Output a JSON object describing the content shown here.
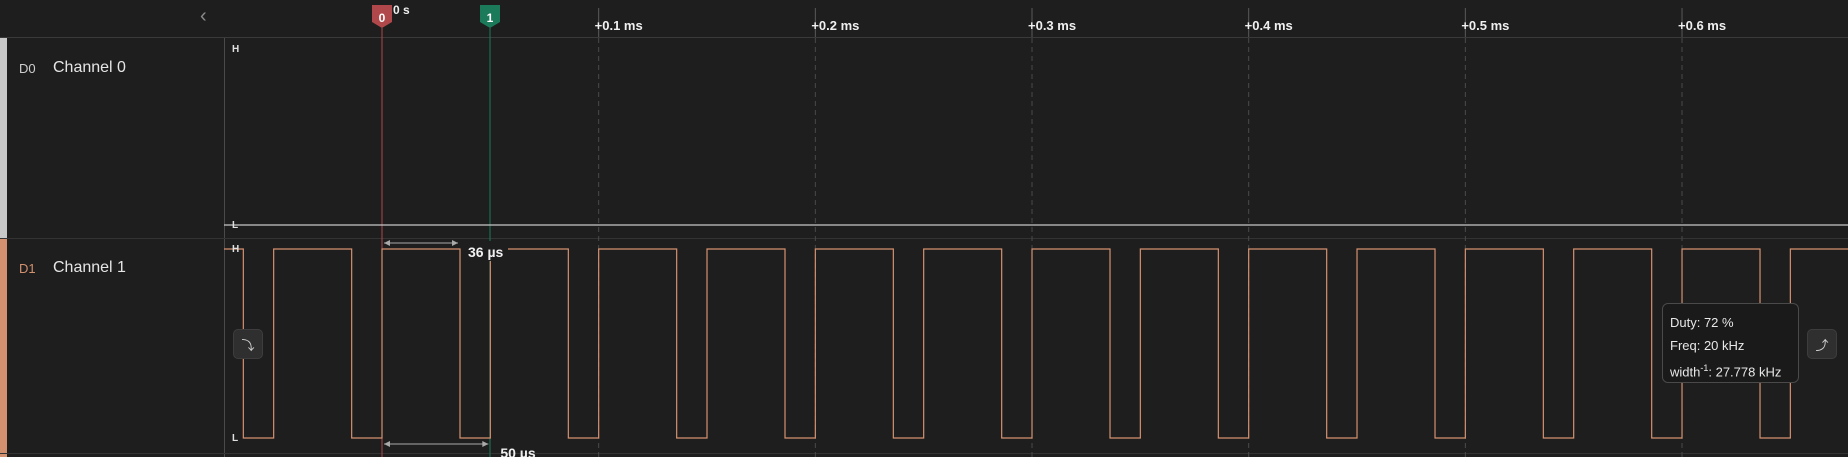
{
  "header": {
    "collapse_icon": "chevron-left-icon",
    "time_origin_label": "0 s",
    "time_ticks": [
      "+0.1 ms",
      "+0.2 ms",
      "+0.3 ms",
      "+0.4 ms",
      "+0.5 ms",
      "+0.6 ms"
    ]
  },
  "markers": [
    {
      "label": "0",
      "color": "#b0474a"
    },
    {
      "label": "1",
      "color": "#1a7a5a"
    }
  ],
  "channels": [
    {
      "id": "D0",
      "name": "Channel 0",
      "color": "#c8c8c8",
      "high_label": "H",
      "low_label": "L"
    },
    {
      "id": "D1",
      "name": "Channel 1",
      "color": "#d4916f",
      "high_label": "H",
      "low_label": "L",
      "trigger_icon": "falling-edge-trigger-icon",
      "next_edge_icon": "rising-edge-search-icon"
    }
  ],
  "measurements": {
    "pulse_width": "36 µs",
    "period": "50 µs"
  },
  "tooltip": {
    "duty": "Duty: 72 %",
    "freq": "Freq: 20 kHz",
    "width_prefix": "width",
    "width_sup": "-1",
    "width_value": ": 27.778 kHz"
  },
  "colors": {
    "background": "#1e1e1e",
    "grid": "#4a4a4a",
    "signal_d1": "#d4916f",
    "signal_d0": "#c8c8c8",
    "marker0": "#b0474a",
    "marker1": "#1a7a5a"
  }
}
